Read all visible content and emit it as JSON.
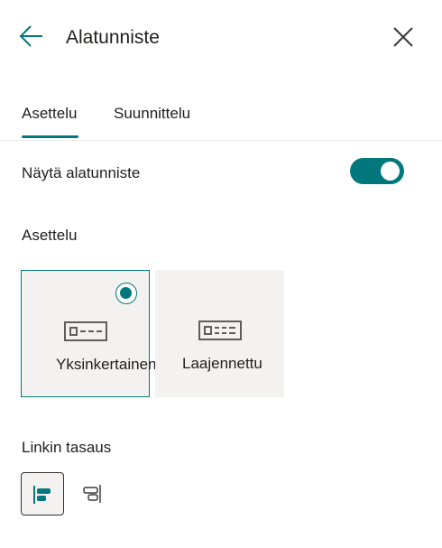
{
  "header": {
    "back_icon": "back-arrow-icon",
    "title": "Alatunniste",
    "close_icon": "close-icon"
  },
  "tabs": [
    {
      "label": "Asettelu",
      "selected": true
    },
    {
      "label": "Suunnittelu",
      "selected": false
    }
  ],
  "show_footer": {
    "label": "Näytä alatunniste",
    "enabled": true
  },
  "layout": {
    "heading": "Asettelu",
    "options": [
      {
        "label": "Yksinkertainen",
        "selected": true,
        "icon": "simple-footer-icon"
      },
      {
        "label": "Laajennettu",
        "selected": false,
        "icon": "extended-footer-icon"
      }
    ]
  },
  "link_alignment": {
    "heading": "Linkin tasaus",
    "options": [
      {
        "icon": "align-left-icon",
        "selected": true
      },
      {
        "icon": "align-right-icon",
        "selected": false
      }
    ]
  },
  "colors": {
    "accent": "#03787c",
    "card_bg": "#f3f2f1",
    "text": "#201f1e"
  }
}
